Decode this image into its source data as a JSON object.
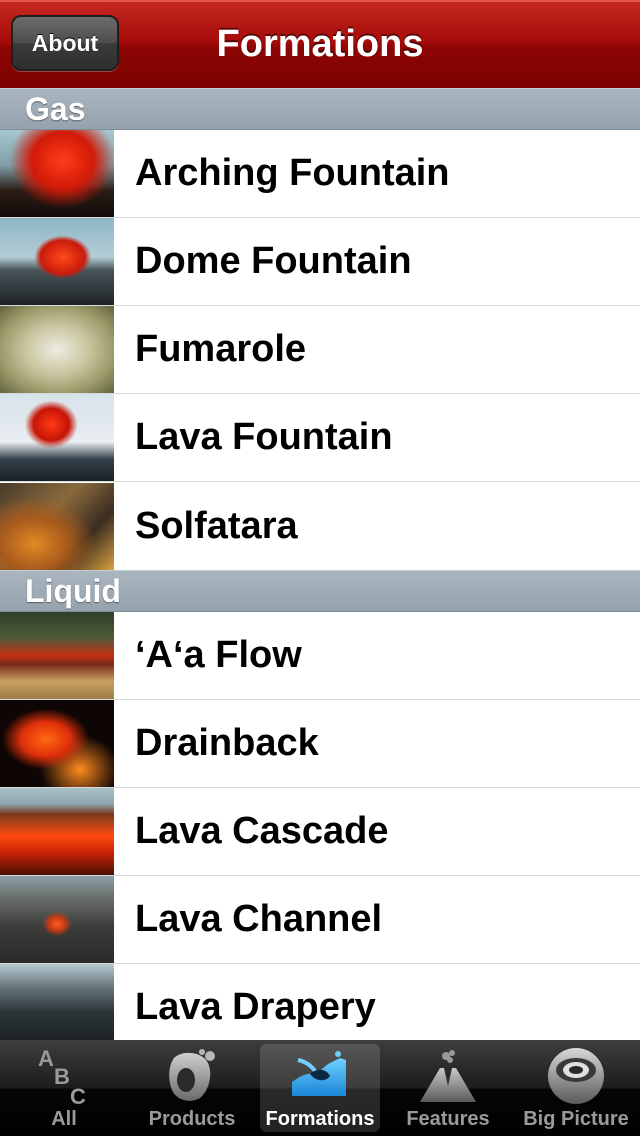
{
  "navbar": {
    "about_label": "About",
    "title": "Formations"
  },
  "sections": [
    {
      "title": "Gas",
      "items": [
        {
          "label": "Arching Fountain"
        },
        {
          "label": "Dome Fountain"
        },
        {
          "label": "Fumarole"
        },
        {
          "label": "Lava Fountain"
        },
        {
          "label": "Solfatara"
        }
      ]
    },
    {
      "title": "Liquid",
      "items": [
        {
          "label": "‘A‘a Flow"
        },
        {
          "label": "Drainback"
        },
        {
          "label": "Lava Cascade"
        },
        {
          "label": "Lava Channel"
        },
        {
          "label": "Lava Drapery"
        }
      ]
    }
  ],
  "tabbar": {
    "tabs": [
      {
        "label": "All",
        "icon": "abc-icon",
        "selected": false
      },
      {
        "label": "Products",
        "icon": "rock-icon",
        "selected": false
      },
      {
        "label": "Formations",
        "icon": "formation-icon",
        "selected": true
      },
      {
        "label": "Features",
        "icon": "volcano-icon",
        "selected": false
      },
      {
        "label": "Big Picture",
        "icon": "earth-cross-section-icon",
        "selected": false
      }
    ]
  },
  "colors": {
    "navbar": "#a90d0a",
    "section_header": "#9eabb5",
    "selected_tab_icon": "#2aa7e8"
  }
}
